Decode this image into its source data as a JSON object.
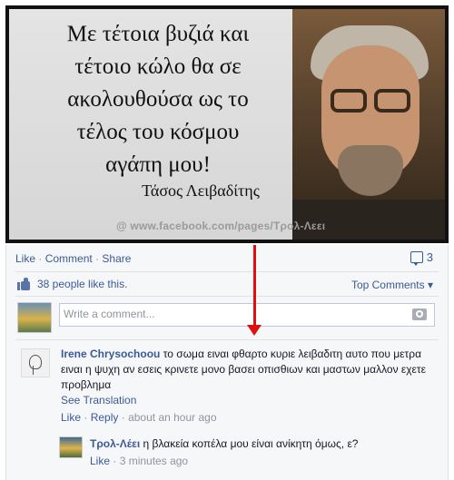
{
  "post_image": {
    "quote_lines": [
      "Με τέτοια βυζιά και",
      "τέτοιο κώλο θα σε",
      "ακολουθούσα ως το",
      "τέλος του κόσμου",
      "αγάπη μου!"
    ],
    "author": "Τάσος Λειβαδίτης",
    "watermark": "@ www.facebook.com/pages/Τρολ-Λεει"
  },
  "actions": {
    "like": "Like",
    "separator": "·",
    "comment": "Comment",
    "share": "Share",
    "comment_count": "3"
  },
  "likes": {
    "text": "38 people like this.",
    "sort_label": "Top Comments ▾"
  },
  "composer": {
    "placeholder": "Write a comment..."
  },
  "comments": [
    {
      "author": "Irene Chrysochoou",
      "text": "το σωμα ειναι φθαρτο κυριε λειβαδιτη αυτο που μετρα ειναι η ψυχη αν εσεις κρινετε μονο βασει οπισθιων και μαστων μαλλον εχετε προβλημα",
      "see_translation": "See Translation",
      "like": "Like",
      "reply": "Reply",
      "time": "about an hour ago"
    }
  ],
  "reply": {
    "author": "Τρολ-Λέει",
    "text": "η βλακεία κοπέλα μου είναι ανίκητη όμως, ε?",
    "like": "Like",
    "time": "3 minutes ago"
  },
  "colors": {
    "link": "#3b5998",
    "arrow": "#e01010",
    "panel": "#f6f7f9"
  }
}
